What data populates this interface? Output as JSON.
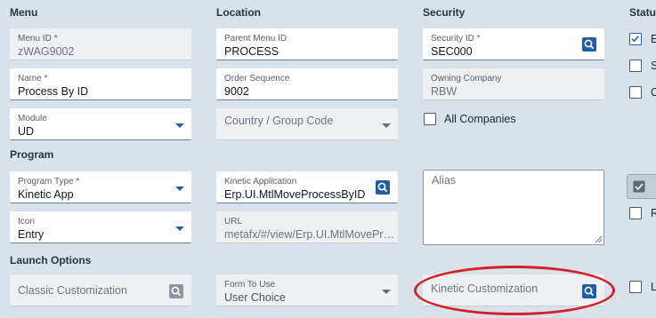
{
  "sections": {
    "menu": "Menu",
    "location": "Location",
    "security": "Security",
    "status": "Status",
    "program": "Program",
    "launch_options": "Launch Options"
  },
  "fields": {
    "menu_id": {
      "label": "Menu ID *",
      "value": "zWAG9002"
    },
    "name": {
      "label": "Name *",
      "value": "Process By ID"
    },
    "module": {
      "label": "Module",
      "value": "UD"
    },
    "parent_menu_id": {
      "label": "Parent Menu ID",
      "value": "PROCESS"
    },
    "order_sequence": {
      "label": "Order Sequence",
      "value": "9002"
    },
    "country_group_code": {
      "placeholder": "Country / Group Code"
    },
    "security_id": {
      "label": "Security ID *",
      "value": "SEC000"
    },
    "owning_company": {
      "label": "Owning Company",
      "value": "RBW"
    },
    "program_type": {
      "label": "Program Type *",
      "value": "Kinetic App"
    },
    "icon": {
      "label": "Icon",
      "value": "Entry"
    },
    "kinetic_application": {
      "label": "Kinetic Application",
      "value": "Erp.UI.MtlMoveProcessByID"
    },
    "url": {
      "label": "URL",
      "value": "metafx/#/view/Erp.UI.MtlMoveProc..."
    },
    "alias": {
      "placeholder": "Alias"
    },
    "classic_customization": {
      "placeholder": "Classic Customization"
    },
    "form_to_use": {
      "label": "Form To Use",
      "value": "User Choice"
    },
    "kinetic_customization": {
      "placeholder": "Kinetic Customization"
    }
  },
  "checkboxes": {
    "all_companies": {
      "label": "All Companies",
      "checked": false
    },
    "status_1": {
      "label": "E",
      "checked": true
    },
    "status_2": {
      "label": "S",
      "checked": false
    },
    "status_3": {
      "label": "O",
      "checked": false
    },
    "status_4": {
      "label": "R",
      "checked": false
    },
    "status_5": {
      "label": "L",
      "checked": false
    }
  },
  "colors": {
    "accent": "#1f5fa8",
    "highlight": "#d62027",
    "background": "#d9e2ea"
  }
}
